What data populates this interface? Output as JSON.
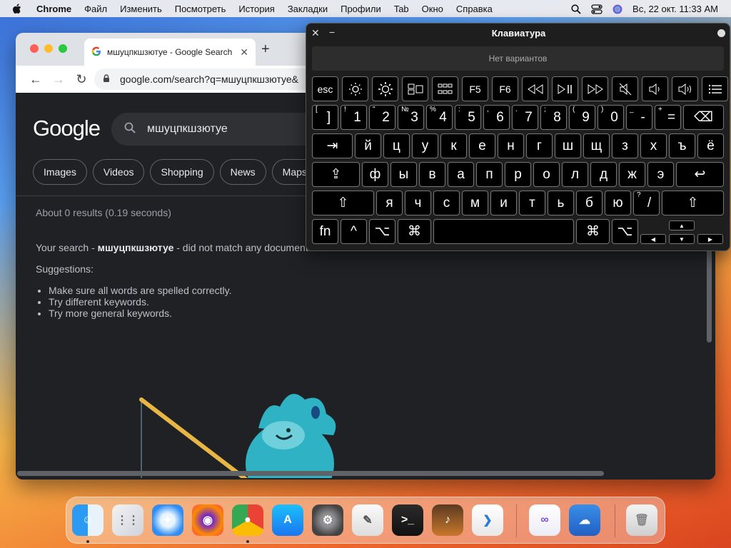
{
  "menubar": {
    "app": "Chrome",
    "items": [
      "Файл",
      "Изменить",
      "Посмотреть",
      "История",
      "Закладки",
      "Профили",
      "Tab",
      "Окно",
      "Справка"
    ],
    "datetime": "Вс, 22 окт.  11:33 AM"
  },
  "browser": {
    "tab_title": "мшуцпкшзютуе - Google Search",
    "url": "google.com/search?q=мшуцпкшзютуе&"
  },
  "google": {
    "logo": "Google",
    "query": "мшуцпкшзютуе",
    "chips": [
      "Images",
      "Videos",
      "Shopping",
      "News",
      "Maps"
    ],
    "stats": "About 0 results (0.19 seconds)",
    "nomatch_prefix": "Your search - ",
    "nomatch_query": "мшуцпкшзютуе",
    "nomatch_suffix": " - did not match any documents.",
    "suggestions_label": "Suggestions:",
    "suggestions": [
      "Make sure all words are spelled correctly.",
      "Try different keywords.",
      "Try more general keywords."
    ]
  },
  "keyboard": {
    "title": "Клавиатура",
    "suggestions": "Нет вариантов",
    "row1": [
      "esc",
      "",
      "",
      "",
      "",
      "F5",
      "F6",
      "",
      "",
      "",
      "",
      "",
      "",
      ""
    ],
    "row1_icons": [
      "",
      "brightness-down-icon",
      "brightness-up-icon",
      "mission-control-icon",
      "launchpad-icon",
      "",
      "",
      "rewind-icon",
      "play-pause-icon",
      "fast-forward-icon",
      "mute-icon",
      "volume-down-icon",
      "volume-up-icon",
      "menu-icon"
    ],
    "row2": [
      [
        "[",
        "]"
      ],
      [
        "!",
        "1"
      ],
      [
        "\"",
        "2"
      ],
      [
        "№",
        "3"
      ],
      [
        "%",
        "4"
      ],
      [
        ":",
        "5"
      ],
      [
        ",",
        "6"
      ],
      [
        ".",
        "7"
      ],
      [
        ";",
        "8"
      ],
      [
        "(",
        "9"
      ],
      [
        ")",
        "0"
      ],
      [
        "_",
        "-"
      ],
      [
        "+",
        "="
      ]
    ],
    "row3": [
      "й",
      "ц",
      "у",
      "к",
      "е",
      "н",
      "г",
      "ш",
      "щ",
      "з",
      "х",
      "ъ",
      "ё"
    ],
    "row4": [
      "ф",
      "ы",
      "в",
      "а",
      "п",
      "р",
      "о",
      "л",
      "д",
      "ж",
      "э"
    ],
    "row5": [
      "я",
      "ч",
      "с",
      "м",
      "и",
      "т",
      "ь",
      "б",
      "ю"
    ],
    "row5_last": [
      "?",
      "/"
    ],
    "row6": {
      "fn": "fn",
      "ctrl": "^",
      "opt": "⌥",
      "cmd": "⌘"
    }
  },
  "dock": {
    "apps": [
      "Finder",
      "Launchpad",
      "Safari",
      "Firefox",
      "Chrome",
      "App Store",
      "System Settings",
      "TextEdit",
      "Terminal",
      "GarageBand",
      "VS Code",
      "Visual Studio",
      "Weather",
      "Trash"
    ]
  }
}
